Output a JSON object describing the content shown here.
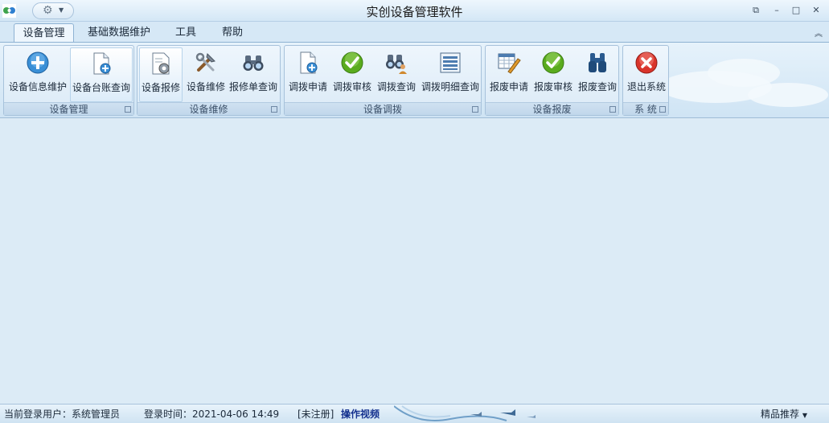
{
  "window": {
    "title": "实创设备管理软件",
    "controls": [
      "restore",
      "minimize",
      "maximize",
      "close"
    ]
  },
  "tabs": [
    {
      "label": "设备管理",
      "active": true
    },
    {
      "label": "基础数据维护",
      "active": false
    },
    {
      "label": "工具",
      "active": false
    },
    {
      "label": "帮助",
      "active": false
    }
  ],
  "ribbon": {
    "groups": [
      {
        "label": "设备管理",
        "buttons": [
          {
            "label": "设备信息维护",
            "icon": "add-circle-icon"
          },
          {
            "label": "设备台账查询",
            "icon": "document-add-icon",
            "selected": true
          }
        ]
      },
      {
        "label": "设备维修",
        "buttons": [
          {
            "label": "设备报修",
            "icon": "document-gear-icon"
          },
          {
            "label": "设备维修",
            "icon": "tools-icon"
          },
          {
            "label": "报修单查询",
            "icon": "binoculars-icon"
          }
        ]
      },
      {
        "label": "设备调拨",
        "buttons": [
          {
            "label": "调拨申请",
            "icon": "document-add-icon"
          },
          {
            "label": "调拨审核",
            "icon": "check-icon"
          },
          {
            "label": "调拨查询",
            "icon": "binoculars-user-icon"
          },
          {
            "label": "调拨明细查询",
            "icon": "list-icon"
          }
        ]
      },
      {
        "label": "设备报废",
        "buttons": [
          {
            "label": "报废申请",
            "icon": "table-edit-icon"
          },
          {
            "label": "报废审核",
            "icon": "check-icon"
          },
          {
            "label": "报废查询",
            "icon": "binoculars-dark-icon"
          }
        ]
      },
      {
        "label": "系 统",
        "buttons": [
          {
            "label": "退出系统",
            "icon": "exit-icon"
          }
        ]
      }
    ]
  },
  "status": {
    "user": "当前登录用户：系统管理员",
    "login_time": "登录时间：2021-04-06 14:49",
    "registration": "[未注册]",
    "video_link": "操作视频",
    "recommend": "精品推荐"
  },
  "colors": {
    "accent": "#15328f",
    "frame": "#dcebf6",
    "check_green": "#5aab1e",
    "exit_red": "#d9342b",
    "plus_blue": "#3a8fd6"
  }
}
